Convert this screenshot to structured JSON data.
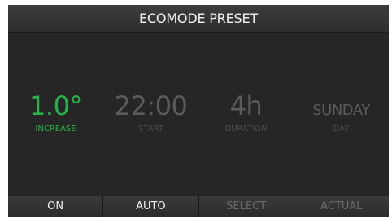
{
  "title": "ECOMODE PRESET",
  "colors": {
    "active": "#27b24a",
    "inactive": "#5b5b5b",
    "background": "#232323"
  },
  "params": [
    {
      "value": "1.0°",
      "label": "INCREASE",
      "state": "active"
    },
    {
      "value": "22:00",
      "label": "START",
      "state": "inactive"
    },
    {
      "value": "4h",
      "label": "DURATION",
      "state": "inactive"
    },
    {
      "value": "SUNDAY",
      "label": "DAY",
      "state": "inactive"
    }
  ],
  "softkeys": [
    {
      "label": "ON",
      "enabled": true
    },
    {
      "label": "AUTO",
      "enabled": true
    },
    {
      "label": "SELECT",
      "enabled": false
    },
    {
      "label": "ACTUAL",
      "enabled": false
    }
  ]
}
